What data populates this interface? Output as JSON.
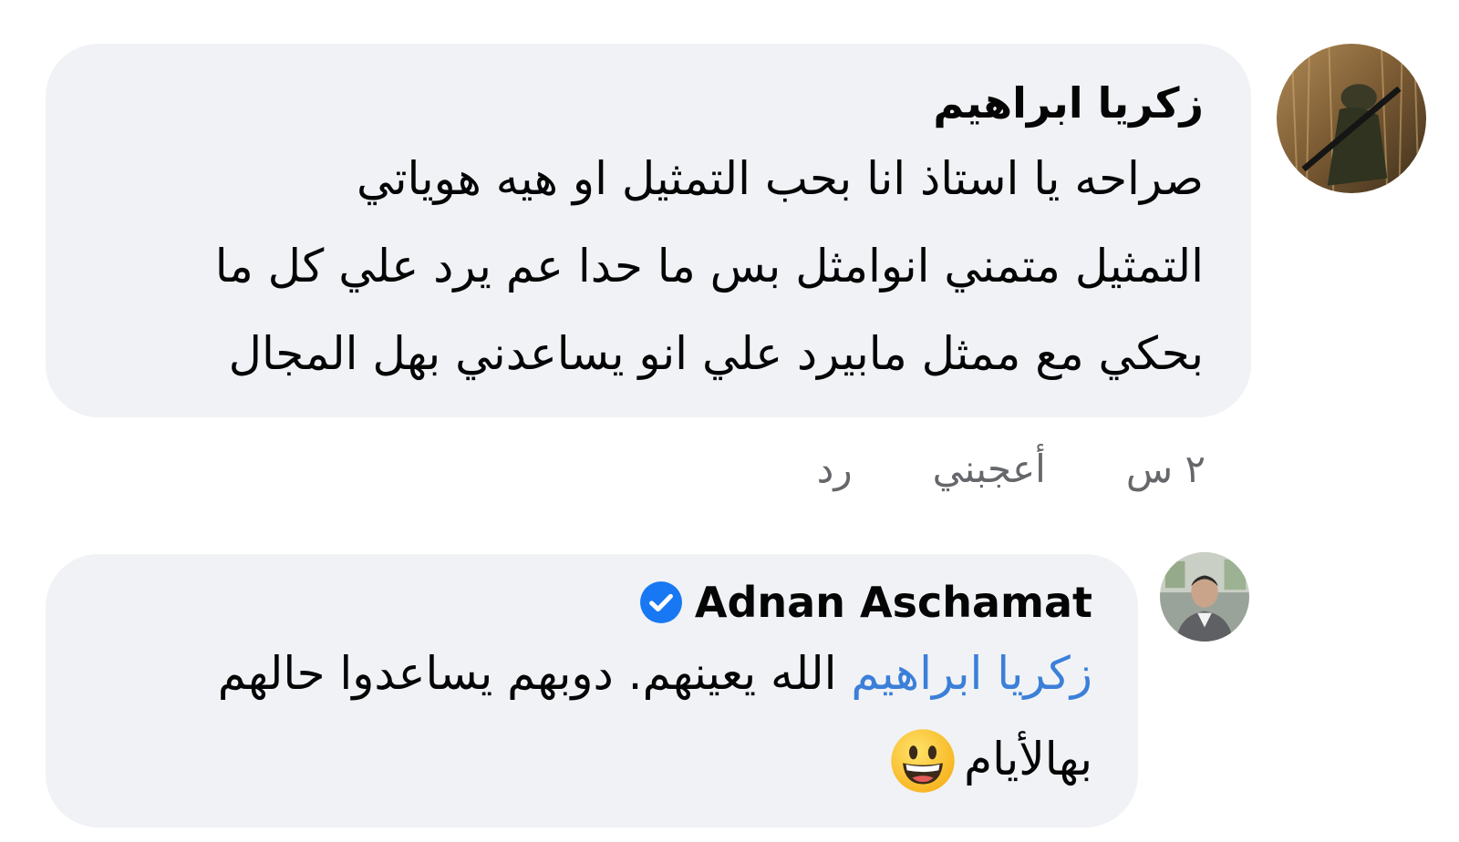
{
  "comments": [
    {
      "author": "زكريا ابراهيم",
      "lines": [
        "صراحه يا استاذ انا بحب التمثيل او هيه هوياتي",
        "التمثيل متمني انوامثل بس ما حدا عم يرد علي كل ما",
        "بحكي مع ممثل مابيرد علي انو يساعدني بهل المجال"
      ],
      "time": "٢ س",
      "like_label": "أعجبني",
      "reply_label": "رد"
    },
    {
      "author": "Adnan Aschamat",
      "verified": true,
      "mention": "زكريا ابراهيم",
      "line1_rest": " الله يعينهم. دوبهم يساعدوا حالهم",
      "line2": "بهالأيام",
      "emoji": "grinning-face-emoji"
    }
  ],
  "colors": {
    "bubble": "#f0f2f5",
    "mention": "#3b7fd9",
    "meta": "#65676b",
    "verified": "#1877f2"
  },
  "icons": [
    "verified-badge-icon",
    "grinning-face-emoji"
  ]
}
